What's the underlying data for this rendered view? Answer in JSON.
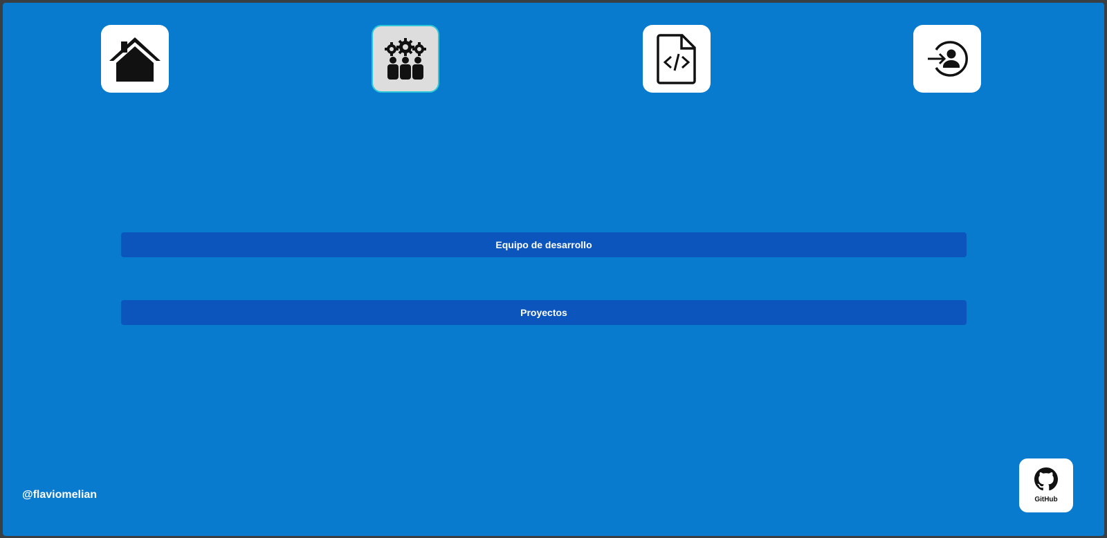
{
  "nav": {
    "items": [
      {
        "icon": "home-icon",
        "active": false
      },
      {
        "icon": "team-gears-icon",
        "active": true
      },
      {
        "icon": "code-file-icon",
        "active": false
      },
      {
        "icon": "login-icon",
        "active": false
      }
    ]
  },
  "main": {
    "team_label": "Equipo de desarrollo",
    "projects_label": "Proyectos"
  },
  "footer": {
    "handle": "@flaviomelian",
    "github_label": "GitHub",
    "github_icon": "github-icon"
  },
  "colors": {
    "background": "#087bcf",
    "button": "#0b55bd",
    "active_border": "#2cc7d9"
  }
}
